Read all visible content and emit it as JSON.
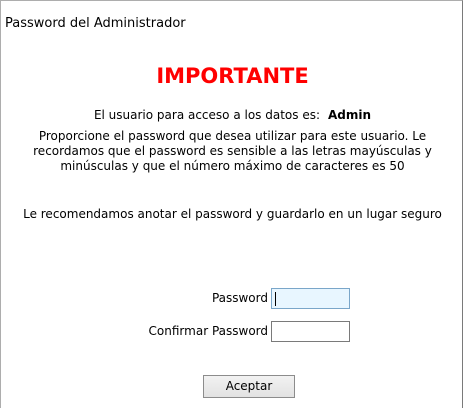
{
  "window": {
    "title": "Password del Administrador"
  },
  "content": {
    "heading": "IMPORTANTE",
    "heading_color": "#ff0000",
    "user_line_text": "El usuario para acceso a los datos es:",
    "user_name": "Admin",
    "instructions": "Proporcione el password que desea utilizar para este usuario. Le recordamos que el password es sensible a las letras mayúsculas y minúsculas y que el número máximo de caracteres es 50",
    "recommendation": "Le recomendamos anotar el password y guardarlo en un lugar seguro"
  },
  "form": {
    "password_label": "Password",
    "password_value": "",
    "confirm_label": "Confirmar Password",
    "confirm_value": "",
    "accept_label": "Aceptar"
  }
}
